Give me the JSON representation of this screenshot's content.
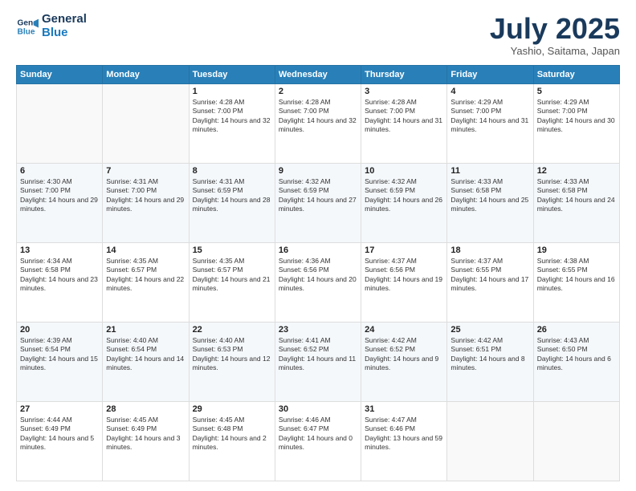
{
  "header": {
    "logo_line1": "General",
    "logo_line2": "Blue",
    "month": "July 2025",
    "location": "Yashio, Saitama, Japan"
  },
  "days_of_week": [
    "Sunday",
    "Monday",
    "Tuesday",
    "Wednesday",
    "Thursday",
    "Friday",
    "Saturday"
  ],
  "weeks": [
    [
      {
        "day": "",
        "info": ""
      },
      {
        "day": "",
        "info": ""
      },
      {
        "day": "1",
        "info": "Sunrise: 4:28 AM\nSunset: 7:00 PM\nDaylight: 14 hours and 32 minutes."
      },
      {
        "day": "2",
        "info": "Sunrise: 4:28 AM\nSunset: 7:00 PM\nDaylight: 14 hours and 32 minutes."
      },
      {
        "day": "3",
        "info": "Sunrise: 4:28 AM\nSunset: 7:00 PM\nDaylight: 14 hours and 31 minutes."
      },
      {
        "day": "4",
        "info": "Sunrise: 4:29 AM\nSunset: 7:00 PM\nDaylight: 14 hours and 31 minutes."
      },
      {
        "day": "5",
        "info": "Sunrise: 4:29 AM\nSunset: 7:00 PM\nDaylight: 14 hours and 30 minutes."
      }
    ],
    [
      {
        "day": "6",
        "info": "Sunrise: 4:30 AM\nSunset: 7:00 PM\nDaylight: 14 hours and 29 minutes."
      },
      {
        "day": "7",
        "info": "Sunrise: 4:31 AM\nSunset: 7:00 PM\nDaylight: 14 hours and 29 minutes."
      },
      {
        "day": "8",
        "info": "Sunrise: 4:31 AM\nSunset: 6:59 PM\nDaylight: 14 hours and 28 minutes."
      },
      {
        "day": "9",
        "info": "Sunrise: 4:32 AM\nSunset: 6:59 PM\nDaylight: 14 hours and 27 minutes."
      },
      {
        "day": "10",
        "info": "Sunrise: 4:32 AM\nSunset: 6:59 PM\nDaylight: 14 hours and 26 minutes."
      },
      {
        "day": "11",
        "info": "Sunrise: 4:33 AM\nSunset: 6:58 PM\nDaylight: 14 hours and 25 minutes."
      },
      {
        "day": "12",
        "info": "Sunrise: 4:33 AM\nSunset: 6:58 PM\nDaylight: 14 hours and 24 minutes."
      }
    ],
    [
      {
        "day": "13",
        "info": "Sunrise: 4:34 AM\nSunset: 6:58 PM\nDaylight: 14 hours and 23 minutes."
      },
      {
        "day": "14",
        "info": "Sunrise: 4:35 AM\nSunset: 6:57 PM\nDaylight: 14 hours and 22 minutes."
      },
      {
        "day": "15",
        "info": "Sunrise: 4:35 AM\nSunset: 6:57 PM\nDaylight: 14 hours and 21 minutes."
      },
      {
        "day": "16",
        "info": "Sunrise: 4:36 AM\nSunset: 6:56 PM\nDaylight: 14 hours and 20 minutes."
      },
      {
        "day": "17",
        "info": "Sunrise: 4:37 AM\nSunset: 6:56 PM\nDaylight: 14 hours and 19 minutes."
      },
      {
        "day": "18",
        "info": "Sunrise: 4:37 AM\nSunset: 6:55 PM\nDaylight: 14 hours and 17 minutes."
      },
      {
        "day": "19",
        "info": "Sunrise: 4:38 AM\nSunset: 6:55 PM\nDaylight: 14 hours and 16 minutes."
      }
    ],
    [
      {
        "day": "20",
        "info": "Sunrise: 4:39 AM\nSunset: 6:54 PM\nDaylight: 14 hours and 15 minutes."
      },
      {
        "day": "21",
        "info": "Sunrise: 4:40 AM\nSunset: 6:54 PM\nDaylight: 14 hours and 14 minutes."
      },
      {
        "day": "22",
        "info": "Sunrise: 4:40 AM\nSunset: 6:53 PM\nDaylight: 14 hours and 12 minutes."
      },
      {
        "day": "23",
        "info": "Sunrise: 4:41 AM\nSunset: 6:52 PM\nDaylight: 14 hours and 11 minutes."
      },
      {
        "day": "24",
        "info": "Sunrise: 4:42 AM\nSunset: 6:52 PM\nDaylight: 14 hours and 9 minutes."
      },
      {
        "day": "25",
        "info": "Sunrise: 4:42 AM\nSunset: 6:51 PM\nDaylight: 14 hours and 8 minutes."
      },
      {
        "day": "26",
        "info": "Sunrise: 4:43 AM\nSunset: 6:50 PM\nDaylight: 14 hours and 6 minutes."
      }
    ],
    [
      {
        "day": "27",
        "info": "Sunrise: 4:44 AM\nSunset: 6:49 PM\nDaylight: 14 hours and 5 minutes."
      },
      {
        "day": "28",
        "info": "Sunrise: 4:45 AM\nSunset: 6:49 PM\nDaylight: 14 hours and 3 minutes."
      },
      {
        "day": "29",
        "info": "Sunrise: 4:45 AM\nSunset: 6:48 PM\nDaylight: 14 hours and 2 minutes."
      },
      {
        "day": "30",
        "info": "Sunrise: 4:46 AM\nSunset: 6:47 PM\nDaylight: 14 hours and 0 minutes."
      },
      {
        "day": "31",
        "info": "Sunrise: 4:47 AM\nSunset: 6:46 PM\nDaylight: 13 hours and 59 minutes."
      },
      {
        "day": "",
        "info": ""
      },
      {
        "day": "",
        "info": ""
      }
    ]
  ]
}
